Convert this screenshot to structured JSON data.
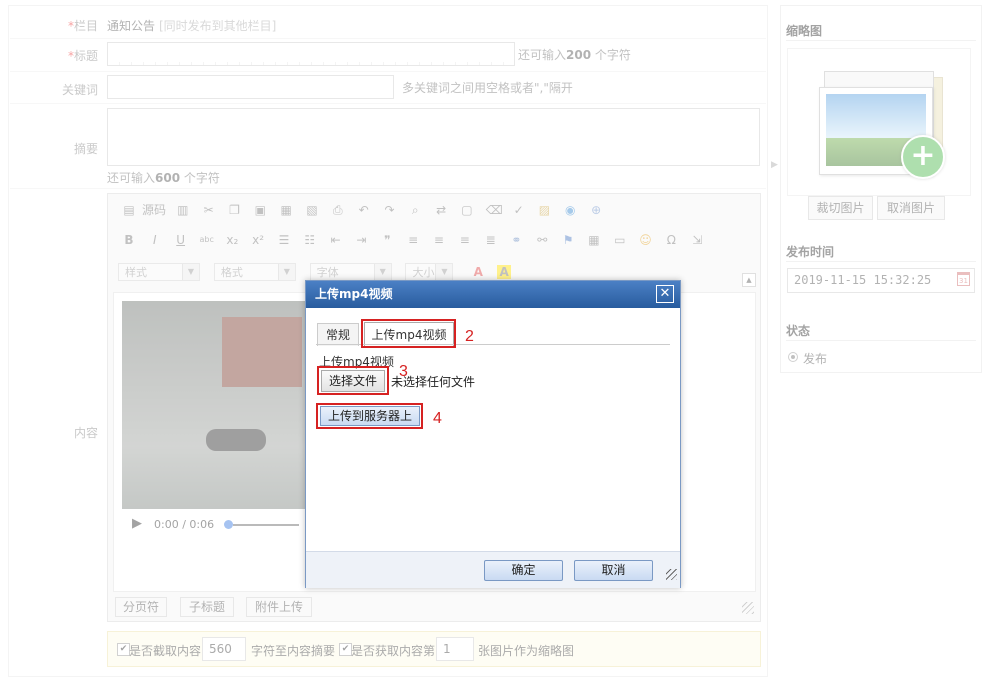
{
  "form": {
    "column_label": "栏目",
    "column_value": "通知公告",
    "column_note": "[同时发布到其他栏目]",
    "title_label": "标题",
    "title_hint_prefix": "还可输入",
    "title_hint_count": "200",
    "title_hint_suffix": "个字符",
    "keywords_label": "关键词",
    "keywords_hint": "多关键词之间用空格或者\",\"隔开",
    "summary_label": "摘要",
    "summary_hint_prefix": "还可输入",
    "summary_hint_count": "600",
    "summary_hint_suffix": "个字符",
    "content_label": "内容",
    "editor": {
      "source_label": "源码",
      "style_combo": "样式",
      "format_combo": "格式",
      "font_combo": "字体",
      "size_combo": "大小",
      "video_time": "0:00 / 0:06",
      "bottom_buttons": [
        "分页符",
        "子标题",
        "附件上传"
      ]
    },
    "options": {
      "truncate_label": "是否截取内容",
      "truncate_value": "560",
      "truncate_suffix": "字符至内容摘要",
      "thumb_label": "是否获取内容第",
      "thumb_value": "1",
      "thumb_suffix": "张图片作为缩略图"
    }
  },
  "sidebar": {
    "thumbnail_title": "缩略图",
    "crop_button": "裁切图片",
    "cancel_button": "取消图片",
    "publish_time_title": "发布时间",
    "publish_time_value": "2019-11-15 15:32:25",
    "status_title": "状态",
    "status_option": "发布"
  },
  "dialog": {
    "title": "上传mp4视频",
    "tabs": [
      "常规",
      "上传mp4视频"
    ],
    "section_label": "上传mp4视频",
    "choose_file_button": "选择文件",
    "no_file_text": "未选择任何文件",
    "upload_button": "上传到服务器上",
    "ok_button": "确定",
    "cancel_button": "取消",
    "annotations": [
      "2",
      "3",
      "4"
    ]
  },
  "colors": {
    "dialog_title_bg": "#2f63a8",
    "annotation_red": "#d62222",
    "required_star": "#e33333"
  }
}
